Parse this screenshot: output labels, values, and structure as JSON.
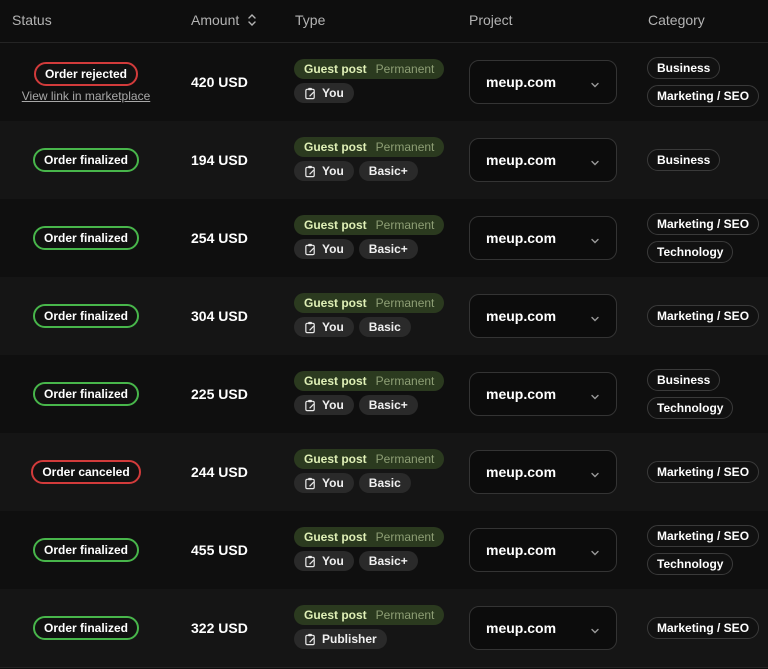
{
  "headers": {
    "status": "Status",
    "amount": "Amount",
    "type": "Type",
    "project": "Project",
    "category": "Category"
  },
  "colors": {
    "finalized": "#48b64b",
    "rejected": "#d23b3b",
    "guest_post_bg": "#2b3a1f"
  },
  "rows": [
    {
      "status": "Order rejected",
      "status_color": "red",
      "link": "View link in marketplace",
      "amount": "420 USD",
      "type_main": "Guest post",
      "type_sub": "Permanent",
      "author": "You",
      "tier": "",
      "project": "meup.com",
      "categories": [
        "Business",
        "Marketing / SEO"
      ]
    },
    {
      "status": "Order finalized",
      "status_color": "green",
      "link": "",
      "amount": "194 USD",
      "type_main": "Guest post",
      "type_sub": "Permanent",
      "author": "You",
      "tier": "Basic+",
      "project": "meup.com",
      "categories": [
        "Business"
      ]
    },
    {
      "status": "Order finalized",
      "status_color": "green",
      "link": "",
      "amount": "254 USD",
      "type_main": "Guest post",
      "type_sub": "Permanent",
      "author": "You",
      "tier": "Basic+",
      "project": "meup.com",
      "categories": [
        "Marketing / SEO",
        "Technology"
      ]
    },
    {
      "status": "Order finalized",
      "status_color": "green",
      "link": "",
      "amount": "304 USD",
      "type_main": "Guest post",
      "type_sub": "Permanent",
      "author": "You",
      "tier": "Basic",
      "project": "meup.com",
      "categories": [
        "Marketing / SEO"
      ]
    },
    {
      "status": "Order finalized",
      "status_color": "green",
      "link": "",
      "amount": "225 USD",
      "type_main": "Guest post",
      "type_sub": "Permanent",
      "author": "You",
      "tier": "Basic+",
      "project": "meup.com",
      "categories": [
        "Business",
        "Technology"
      ]
    },
    {
      "status": "Order canceled",
      "status_color": "red",
      "link": "",
      "amount": "244 USD",
      "type_main": "Guest post",
      "type_sub": "Permanent",
      "author": "You",
      "tier": "Basic",
      "project": "meup.com",
      "categories": [
        "Marketing / SEO"
      ]
    },
    {
      "status": "Order finalized",
      "status_color": "green",
      "link": "",
      "amount": "455 USD",
      "type_main": "Guest post",
      "type_sub": "Permanent",
      "author": "You",
      "tier": "Basic+",
      "project": "meup.com",
      "categories": [
        "Marketing / SEO",
        "Technology"
      ]
    },
    {
      "status": "Order finalized",
      "status_color": "green",
      "link": "",
      "amount": "322 USD",
      "type_main": "Guest post",
      "type_sub": "Permanent",
      "author": "Publisher",
      "tier": "",
      "project": "meup.com",
      "categories": [
        "Marketing / SEO"
      ]
    }
  ]
}
